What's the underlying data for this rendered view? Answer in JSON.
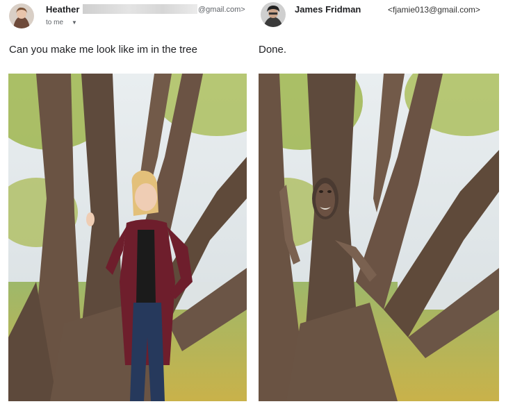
{
  "left": {
    "sender": {
      "name": "Heather",
      "email_suffix": "@gmail.com>",
      "recipient": "to me",
      "avatar_icon": "user-avatar-photo"
    },
    "message": "Can you make me look like im in the tree",
    "photo": {
      "subject": "photo-woman-by-tree"
    }
  },
  "right": {
    "sender": {
      "name": "James Fridman",
      "email": "<fjamie013@gmail.com>",
      "avatar_icon": "user-avatar-photo"
    },
    "message": "Done.",
    "photo": {
      "subject": "photo-face-in-tree"
    }
  },
  "icons": {
    "caret": "chevron-down-icon"
  },
  "colors": {
    "text": "#202124",
    "muted": "#5f6368",
    "bark": "#6b5344",
    "leaves": "#b8c25a"
  }
}
